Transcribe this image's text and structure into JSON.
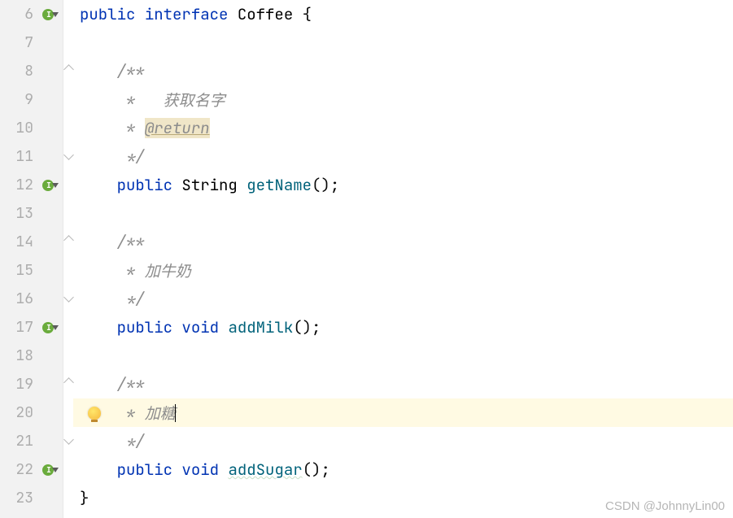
{
  "gutter": {
    "lines": [
      "6",
      "7",
      "8",
      "9",
      "10",
      "11",
      "12",
      "13",
      "14",
      "15",
      "16",
      "17",
      "18",
      "19",
      "20",
      "21",
      "22",
      "23"
    ],
    "impl_lines": [
      6,
      12,
      17,
      22
    ],
    "bulb_line": 20
  },
  "code": {
    "l6": {
      "kw1": "public",
      "kw2": "interface",
      "cls": "Coffee",
      "brace": " {"
    },
    "l8": {
      "c": "/**"
    },
    "l9": {
      "c": " *   获取名字"
    },
    "l10": {
      "pre": " * ",
      "tag": "@return"
    },
    "l11": {
      "c": " */"
    },
    "l12": {
      "kw": "public",
      "type": "String",
      "method": "getName",
      "tail": "();"
    },
    "l14": {
      "c": "/**"
    },
    "l15": {
      "c": " * 加牛奶"
    },
    "l16": {
      "c": " */"
    },
    "l17": {
      "kw": "public",
      "vd": "void",
      "method": "addMilk",
      "tail": "();"
    },
    "l19": {
      "c": "/**"
    },
    "l20": {
      "c": " * 加糖"
    },
    "l21": {
      "c": " */"
    },
    "l22": {
      "kw": "public",
      "vd": "void",
      "method": "addSugar",
      "tail": "();"
    },
    "l23": {
      "brace": "}"
    }
  },
  "watermark": "CSDN @JohnnyLin00"
}
